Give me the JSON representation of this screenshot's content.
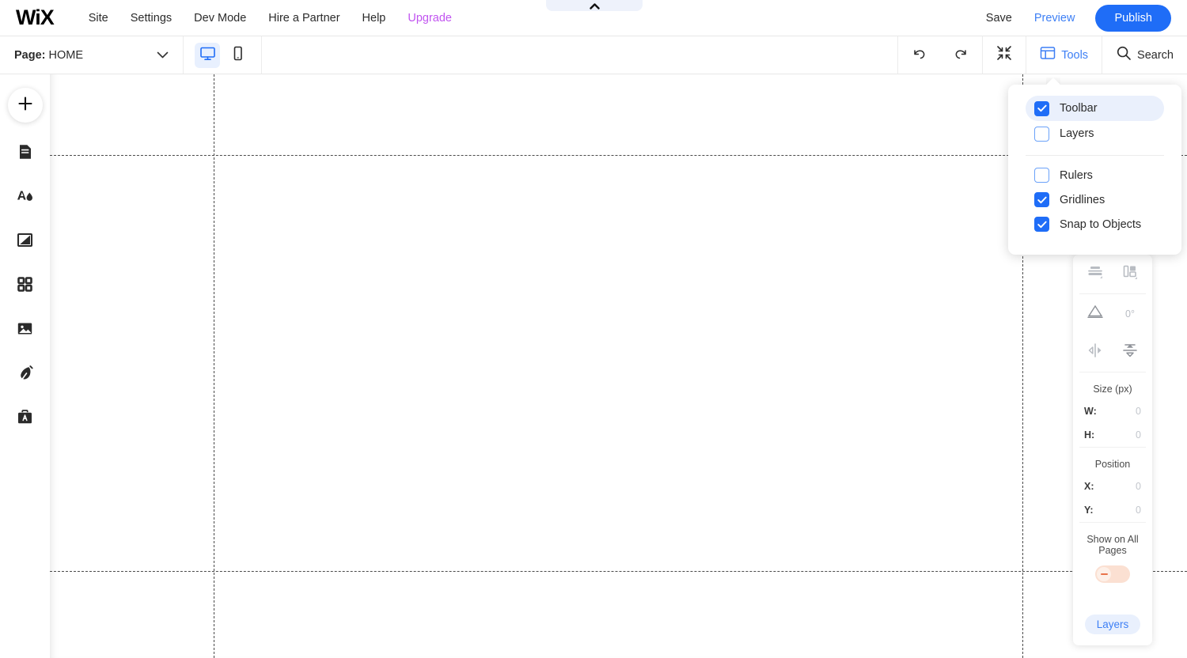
{
  "topbar": {
    "logo": "WiX",
    "menu": [
      {
        "label": "Site"
      },
      {
        "label": "Settings"
      },
      {
        "label": "Dev Mode"
      },
      {
        "label": "Hire a Partner"
      },
      {
        "label": "Help"
      },
      {
        "label": "Upgrade",
        "accent": "#c154f0"
      }
    ],
    "save_label": "Save",
    "preview_label": "Preview",
    "publish_label": "Publish",
    "center_tab_icon": "chevron-up-icon"
  },
  "subbar": {
    "page_prefix": "Page:",
    "page_name": "HOME",
    "page_chevron_icon": "chevron-down-icon",
    "desktop_icon": "desktop-icon",
    "mobile_icon": "mobile-icon",
    "undo_icon": "undo-icon",
    "redo_icon": "redo-icon",
    "zoom_out_icon": "zoom-out-icon",
    "tools_icon": "panel-layout-icon",
    "tools_label": "Tools",
    "search_icon": "search-icon",
    "search_label": "Search"
  },
  "left_rail": {
    "add_icon": "plus-icon",
    "items": [
      {
        "icon": "pages-icon",
        "name": "pages"
      },
      {
        "icon": "theme-design-icon",
        "name": "theme-design"
      },
      {
        "icon": "background-icon",
        "name": "background"
      },
      {
        "icon": "apps-grid-icon",
        "name": "apps"
      },
      {
        "icon": "media-image-icon",
        "name": "media"
      },
      {
        "icon": "blog-pen-icon",
        "name": "blog"
      },
      {
        "icon": "marketing-briefcase-icon",
        "name": "marketing"
      }
    ]
  },
  "canvas": {
    "gridlines_vertical": [
      207,
      1229
    ],
    "gridlines_horizontal": [
      102,
      628
    ]
  },
  "tools_dropdown": {
    "group1": [
      {
        "label": "Toolbar",
        "checked": true,
        "highlighted": true
      },
      {
        "label": "Layers",
        "checked": false,
        "highlighted": false
      }
    ],
    "group2": [
      {
        "label": "Rulers",
        "checked": false
      },
      {
        "label": "Gridlines",
        "checked": true
      },
      {
        "label": "Snap to Objects",
        "checked": true
      }
    ]
  },
  "tool_panel": {
    "align_icon": "align-vertical-icon",
    "distribute_icon": "distribute-horizontal-icon",
    "rotate_icon": "rotate-angle-icon",
    "rotate_value": "0°",
    "flip_h_icon": "flip-horizontal-icon",
    "flip_v_icon": "flip-vertical-icon",
    "size_title": "Size (px)",
    "width_key": "W:",
    "width_value": "0",
    "height_key": "H:",
    "height_value": "0",
    "position_title": "Position",
    "x_key": "X:",
    "x_value": "0",
    "y_key": "Y:",
    "y_value": "0",
    "show_all_title": "Show on All Pages",
    "show_all_on": false,
    "layers_label": "Layers"
  },
  "colors": {
    "accent_blue": "#1f6df7",
    "link_blue": "#3d7ff5",
    "upgrade_purple": "#c154f0",
    "toggle_off_track": "#fbe0d2",
    "toggle_off_mark": "#e8734a"
  }
}
